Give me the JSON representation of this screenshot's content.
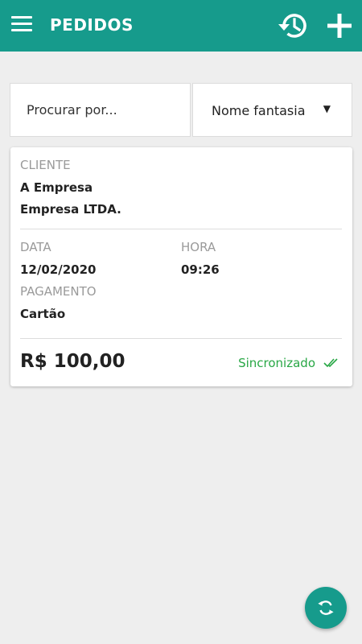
{
  "appbar": {
    "title": "PEDIDOS",
    "menu_icon": "menu-icon",
    "history_icon": "history-icon",
    "add_icon": "plus-icon",
    "color": "#169b8c"
  },
  "search": {
    "placeholder": "Procurar por...",
    "value": "",
    "filter_selected": "Nome fantasia"
  },
  "order": {
    "cliente_label": "CLIENTE",
    "cliente_nome": "A Empresa",
    "cliente_razao": "Empresa LTDA.",
    "data_label": "DATA",
    "data_value": "12/02/2020",
    "hora_label": "HORA",
    "hora_value": "09:26",
    "pagamento_label": "PAGAMENTO",
    "pagamento_value": "Cartão",
    "total": "R$ 100,00",
    "status": "Sincronizado",
    "status_color": "#28a745",
    "status_icon": "double-check-icon"
  },
  "fab": {
    "icon": "sync-icon"
  }
}
